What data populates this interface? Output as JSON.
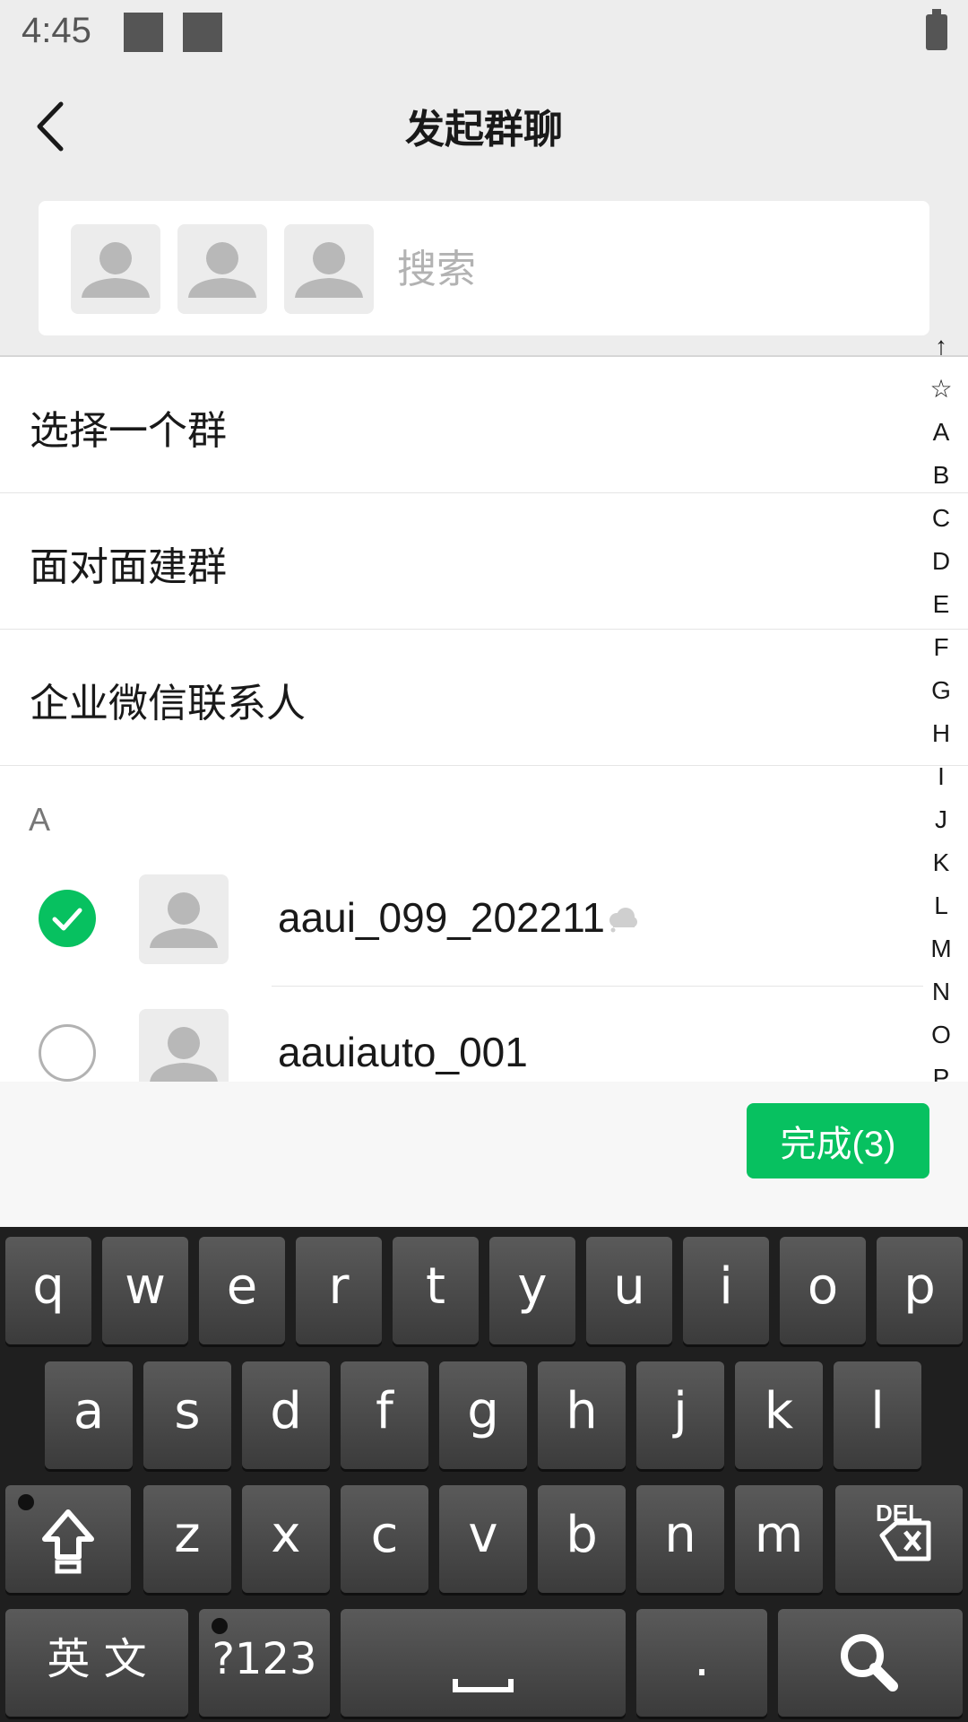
{
  "status_bar": {
    "time": "4:45"
  },
  "header": {
    "title": "发起群聊"
  },
  "search": {
    "placeholder": "搜索"
  },
  "menu": {
    "items": [
      {
        "label": "选择一个群"
      },
      {
        "label": "面对面建群"
      },
      {
        "label": "企业微信联系人"
      }
    ]
  },
  "contacts": {
    "section_letter": "A",
    "items": [
      {
        "name": "aaui_099_202211",
        "checked": true
      },
      {
        "name": "aauiauto_001",
        "checked": false
      }
    ]
  },
  "alphabet_index": [
    "↑",
    "☆",
    "A",
    "B",
    "C",
    "D",
    "E",
    "F",
    "G",
    "H",
    "I",
    "J",
    "K",
    "L",
    "M",
    "N",
    "O",
    "P"
  ],
  "bottom_bar": {
    "done_label": "完成(3)"
  },
  "keyboard": {
    "row1": [
      "q",
      "w",
      "e",
      "r",
      "t",
      "y",
      "u",
      "i",
      "o",
      "p"
    ],
    "row2": [
      "a",
      "s",
      "d",
      "f",
      "g",
      "h",
      "j",
      "k",
      "l"
    ],
    "row3": [
      "z",
      "x",
      "c",
      "v",
      "b",
      "n",
      "m"
    ],
    "lang_label": "英 文",
    "symbols_label": "?123",
    "period_label": ".",
    "del_label": "DEL"
  },
  "colors": {
    "accent": "#07c160",
    "header_bg": "#ededed",
    "keyboard_bg": "#1f1f1f"
  },
  "icons": {
    "back": "chevron-left-icon",
    "avatar": "person-silhouette-icon",
    "check": "checkmark-icon",
    "cloud": "cloud-icon",
    "shift": "shift-arrow-icon",
    "delete": "backspace-icon",
    "space": "space-bar-icon",
    "search": "magnifier-icon"
  }
}
